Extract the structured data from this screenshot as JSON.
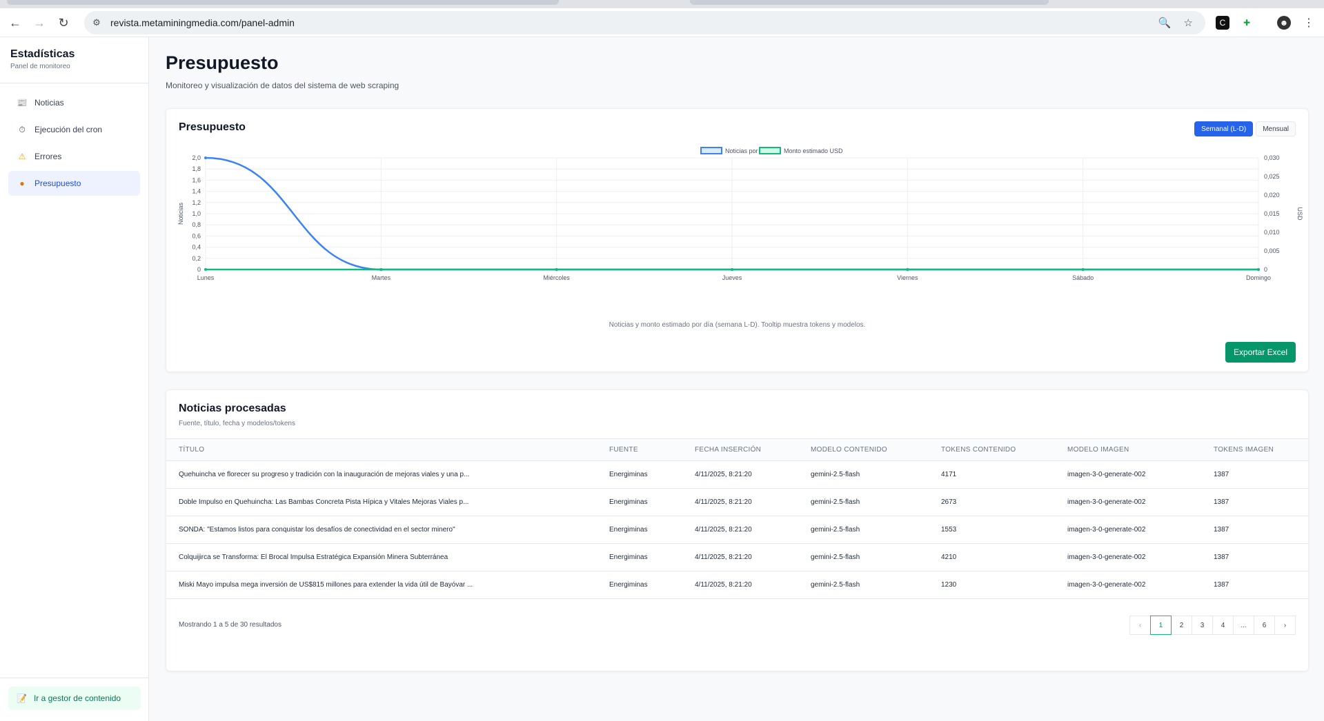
{
  "browser": {
    "url": "revista.metaminingmedia.com/panel-admin"
  },
  "sidebar": {
    "title": "Estadísticas",
    "subtitle": "Panel de monitoreo",
    "items": [
      {
        "label": "Noticias",
        "icon": "newspaper-icon"
      },
      {
        "label": "Ejecución del cron",
        "icon": "stopwatch-icon"
      },
      {
        "label": "Errores",
        "icon": "warning-icon"
      },
      {
        "label": "Presupuesto",
        "icon": "money-bag-icon"
      }
    ],
    "active_index": 3,
    "bottom_link": "Ir a gestor de contenido"
  },
  "page": {
    "title": "Presupuesto",
    "subtitle": "Monitoreo y visualización de datos del sistema de web scraping"
  },
  "budget_card": {
    "title": "Presupuesto",
    "toggle": {
      "weekly": "Semanal (L-D)",
      "monthly": "Mensual",
      "selected": "weekly"
    },
    "caption": "Noticias y monto estimado por día (semana L-D). Tooltip muestra tokens y modelos.",
    "export_label": "Exportar Excel"
  },
  "chart_data": {
    "type": "line",
    "categories": [
      "Lunes",
      "Martes",
      "Miércoles",
      "Jueves",
      "Viernes",
      "Sábado",
      "Domingo"
    ],
    "series": [
      {
        "name": "Noticias por día",
        "axis": "left",
        "color": "#3b82f6",
        "values": [
          2,
          0,
          0,
          0,
          0,
          0,
          0
        ]
      },
      {
        "name": "Monto estimado USD",
        "axis": "right",
        "color": "#10b981",
        "values": [
          0,
          0,
          0,
          0,
          0,
          0,
          0
        ]
      }
    ],
    "ylabel": "Noticias",
    "y2label": "USD",
    "ylim": [
      0,
      2
    ],
    "y2lim": [
      0,
      0.03
    ],
    "yticks": [
      "0",
      "0,2",
      "0,4",
      "0,6",
      "0,8",
      "1,0",
      "1,2",
      "1,4",
      "1,6",
      "1,8",
      "2,0"
    ],
    "y2ticks": [
      "0",
      "0,005",
      "0,010",
      "0,015",
      "0,020",
      "0,025",
      "0,030"
    ],
    "grid": true,
    "legend": "top-center"
  },
  "news_card": {
    "title": "Noticias procesadas",
    "subtitle": "Fuente, título, fecha y modelos/tokens",
    "columns": [
      "TÍTULO",
      "FUENTE",
      "FECHA INSERCIÓN",
      "MODELO CONTENIDO",
      "TOKENS CONTENIDO",
      "MODELO IMAGEN",
      "TOKENS IMAGEN"
    ],
    "rows": [
      [
        "Quehuincha ve florecer su progreso y tradición con la inauguración de mejoras viales y una p...",
        "Energiminas",
        "4/11/2025, 8:21:20",
        "gemini-2.5-flash",
        "4171",
        "imagen-3-0-generate-002",
        "1387"
      ],
      [
        "Doble Impulso en Quehuincha: Las Bambas Concreta Pista Hípica y Vitales Mejoras Viales p...",
        "Energiminas",
        "4/11/2025, 8:21:20",
        "gemini-2.5-flash",
        "2673",
        "imagen-3-0-generate-002",
        "1387"
      ],
      [
        "SONDA: \"Estamos listos para conquistar los desafíos de conectividad en el sector minero\"",
        "Energiminas",
        "4/11/2025, 8:21:20",
        "gemini-2.5-flash",
        "1553",
        "imagen-3-0-generate-002",
        "1387"
      ],
      [
        "Colquijirca se Transforma: El Brocal Impulsa Estratégica Expansión Minera Subterránea",
        "Energiminas",
        "4/11/2025, 8:21:20",
        "gemini-2.5-flash",
        "4210",
        "imagen-3-0-generate-002",
        "1387"
      ],
      [
        "Miski Mayo impulsa mega inversión de US$815 millones para extender la vida útil de Bayóvar ...",
        "Energiminas",
        "4/11/2025, 8:21:20",
        "gemini-2.5-flash",
        "1230",
        "imagen-3-0-generate-002",
        "1387"
      ]
    ],
    "showing": "Mostrando 1 a 5 de 30 resultados",
    "pagination": {
      "prev": "‹",
      "pages": [
        "1",
        "2",
        "3",
        "4",
        "...",
        "6"
      ],
      "next": "›",
      "current": "1"
    }
  }
}
